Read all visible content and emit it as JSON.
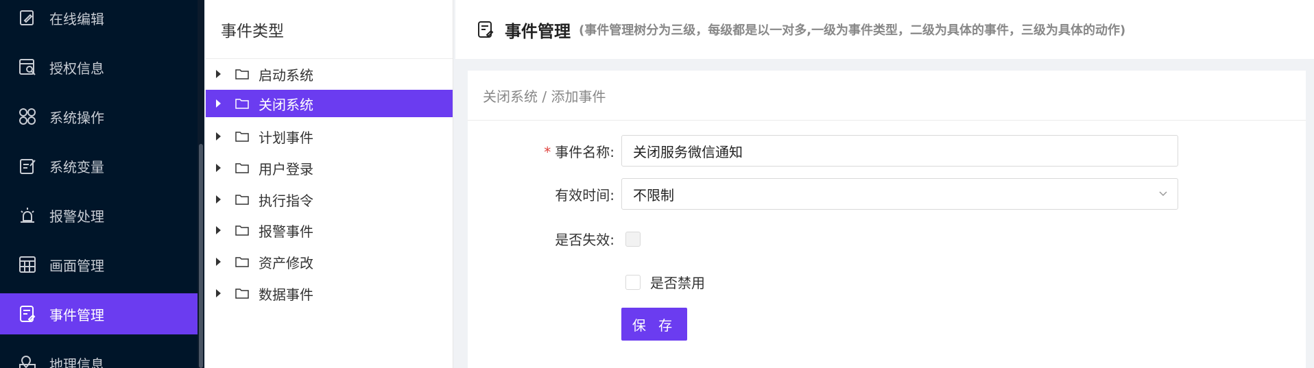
{
  "nav": {
    "items": [
      {
        "label": "在线编辑",
        "icon": "edit-icon"
      },
      {
        "label": "授权信息",
        "icon": "license-icon"
      },
      {
        "label": "系统操作",
        "icon": "system-operation-icon"
      },
      {
        "label": "系统变量",
        "icon": "variable-icon"
      },
      {
        "label": "报警处理",
        "icon": "alarm-icon"
      },
      {
        "label": "画面管理",
        "icon": "screen-grid-icon"
      },
      {
        "label": "事件管理",
        "icon": "event-icon"
      },
      {
        "label": "地理信息",
        "icon": "map-icon"
      }
    ],
    "active_index": 6
  },
  "tree": {
    "title": "事件类型",
    "items": [
      "启动系统",
      "关闭系统",
      "计划事件",
      "用户登录",
      "执行指令",
      "报警事件",
      "资产修改",
      "数据事件"
    ],
    "selected_index": 1
  },
  "header": {
    "title": "事件管理",
    "subtitle": "(事件管理树分为三级，每级都是以一对多,一级为事件类型，二级为具体的事件，三级为具体的动作)"
  },
  "form": {
    "breadcrumb": "关闭系统 / 添加事件",
    "required_mark": "*",
    "name_label": "事件名称:",
    "name_value": "关闭服务微信通知",
    "time_label": "有效时间:",
    "time_value": "不限制",
    "invalid_label": "是否失效:",
    "disabled_label": "是否禁用",
    "save_label": "保 存"
  },
  "colors": {
    "accent": "#6b3cf0",
    "nav_bg": "#001529",
    "required": "#e0433f"
  }
}
